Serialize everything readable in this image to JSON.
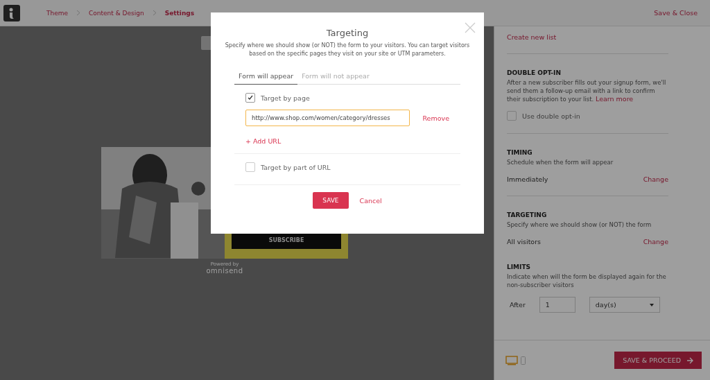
{
  "topbar": {
    "breadcrumbs": [
      {
        "label": "Theme",
        "selected": false
      },
      {
        "label": "Content & Design",
        "selected": false
      },
      {
        "label": "Settings",
        "selected": true
      }
    ],
    "action": "Save & Close"
  },
  "preview": {
    "subscribe": "SUBSCRIBE",
    "powered_by": "Powered by",
    "brand": "omnisend"
  },
  "panel": {
    "top_link": "Create new list",
    "double_opt_in": {
      "title": "DOUBLE OPT-IN",
      "description": "After a new subscriber fills out your signup form, we'll send them a follow-up email with a link to confirm their subscription to your list.",
      "link": "Learn more",
      "checkbox": {
        "label": "Use double opt-in",
        "checked": false
      }
    },
    "timing": {
      "title": "TIMING",
      "description": "Schedule when the form will appear",
      "value": "Immediately",
      "action": "Change"
    },
    "targeting": {
      "title": "TARGETING",
      "description": "Specify where we should show (or NOT) the form",
      "value": "All visitors",
      "action": "Change"
    },
    "limits": {
      "title": "LIMITS",
      "description": "Indicate when will the form be displayed again for the non-subscriber visitors",
      "after_label": "After",
      "after_value": "1",
      "unit": "day(s)"
    },
    "devices": [
      {
        "kind": "desktop",
        "selected": true
      },
      {
        "kind": "mobile",
        "selected": false
      }
    ],
    "proceed": "SAVE & PROCEED"
  },
  "modal": {
    "title": "Targeting",
    "description": "Specify where we should show (or NOT) the form to your visitors. You can target visitors based on the specific pages they visit on your site or UTM parameters.",
    "tabs": [
      {
        "label": "Form will appear",
        "selected": true
      },
      {
        "label": "Form will not appear",
        "selected": false
      }
    ],
    "options": [
      {
        "label": "Target by page",
        "checked": true,
        "urls": [
          {
            "value": "http://www.shop.com/women/category/dresses",
            "remove": "Remove"
          }
        ],
        "add": "+ Add URL"
      },
      {
        "label": "Target by part of URL",
        "checked": false
      }
    ],
    "save": "SAVE",
    "cancel": "Cancel"
  }
}
